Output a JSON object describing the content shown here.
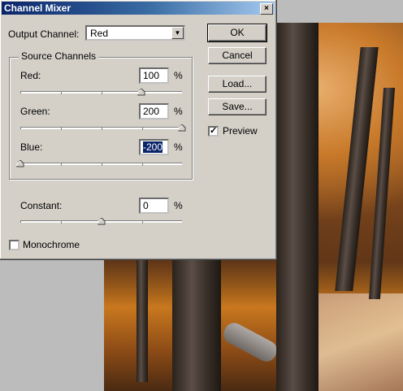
{
  "window": {
    "title": "Channel Mixer",
    "close_label": "×"
  },
  "output_channel": {
    "label": "Output Channel:",
    "value": "Red",
    "arrow": "▼"
  },
  "source_channels": {
    "legend": "Source Channels",
    "red": {
      "label": "Red:",
      "value": "100",
      "unit": "%",
      "slider_percent": 100
    },
    "green": {
      "label": "Green:",
      "value": "200",
      "unit": "%",
      "slider_percent": 200
    },
    "blue": {
      "label": "Blue:",
      "value": "-200",
      "unit": "%",
      "slider_percent": -200
    }
  },
  "constant": {
    "label": "Constant:",
    "value": "0",
    "unit": "%",
    "slider_percent": 0
  },
  "monochrome": {
    "label": "Monochrome",
    "checked": false
  },
  "preview": {
    "label": "Preview",
    "checked": true,
    "check_glyph": "✓"
  },
  "buttons": {
    "ok": "OK",
    "cancel": "Cancel",
    "load": "Load...",
    "save": "Save..."
  }
}
